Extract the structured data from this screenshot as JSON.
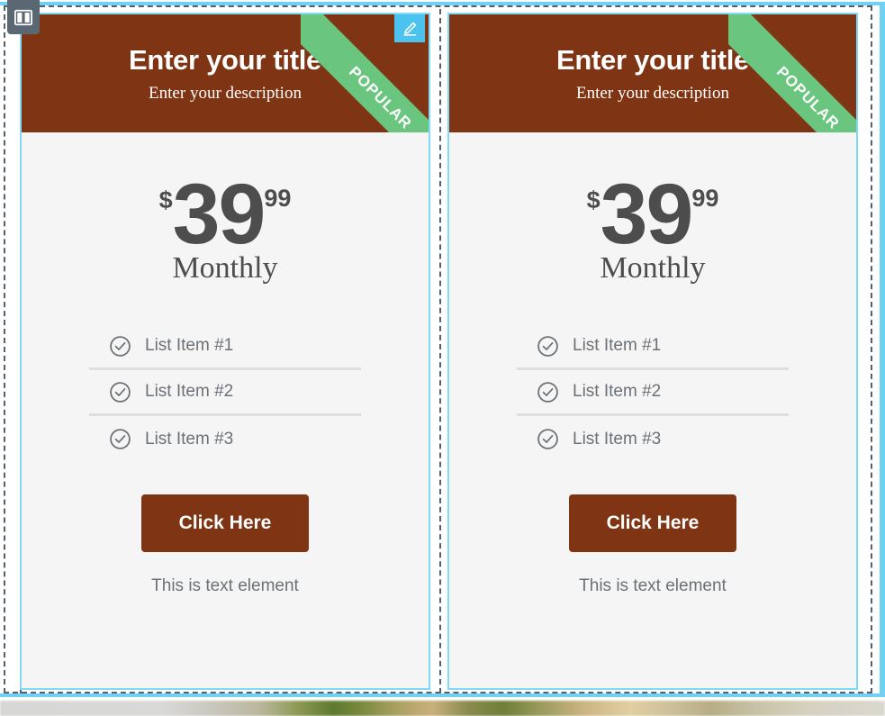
{
  "toolbar": {
    "columns_badge_icon": "columns-layout-icon",
    "edit_badge_icon": "pencil-edit-icon"
  },
  "colors": {
    "header_brown": "#7f3413",
    "ribbon_green": "#6ac57e",
    "card_background": "#f5f5f5",
    "selection_cyan": "#6fd2f5",
    "badge_blue": "#4cc3ef",
    "badge_slate": "#5a6874",
    "price_text": "#4d4d4d",
    "muted_text": "#6b7177",
    "divider_gray": "#dedede"
  },
  "columns": [
    {
      "id": "column-1",
      "card": {
        "ribbon": "POPULAR",
        "title": "Enter your title",
        "subtitle": "Enter your description",
        "price": {
          "currency": "$",
          "amount": "39",
          "cents": "99",
          "period": "Monthly"
        },
        "features": [
          {
            "icon": "check-circle-icon",
            "label": "List Item #1"
          },
          {
            "icon": "check-circle-icon",
            "label": "List Item #2"
          },
          {
            "icon": "check-circle-icon",
            "label": "List Item #3"
          }
        ],
        "cta_label": "Click Here",
        "footer_text": "This is text element"
      }
    },
    {
      "id": "column-2",
      "card": {
        "ribbon": "POPULAR",
        "title": "Enter your title",
        "subtitle": "Enter your description",
        "price": {
          "currency": "$",
          "amount": "39",
          "cents": "99",
          "period": "Monthly"
        },
        "features": [
          {
            "icon": "check-circle-icon",
            "label": "List Item #1"
          },
          {
            "icon": "check-circle-icon",
            "label": "List Item #2"
          },
          {
            "icon": "check-circle-icon",
            "label": "List Item #3"
          }
        ],
        "cta_label": "Click Here",
        "footer_text": "This is text element"
      }
    }
  ]
}
